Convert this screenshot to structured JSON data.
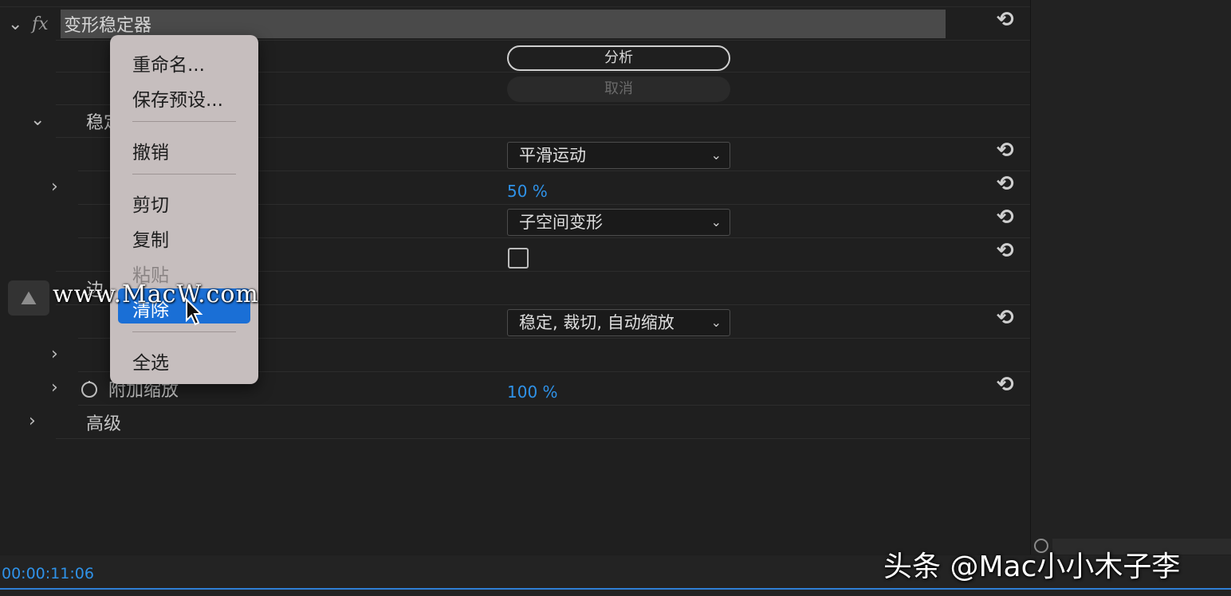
{
  "effect": {
    "name": "变形稳定器",
    "fx_label": "fx",
    "analyze_label": "分析",
    "cancel_label": "取消"
  },
  "sections": {
    "stabilize_partial": "稳定",
    "border_partial": "边",
    "extra_scale_label": "附加缩放",
    "advanced_label": "高级"
  },
  "params": {
    "result_value": "平滑运动",
    "smoothness_value": "50 %",
    "method_value": "子空间变形",
    "framing_value": "稳定, 裁切, 自动缩放",
    "extra_scale_value": "100 %"
  },
  "context_menu": {
    "items": [
      "重命名...",
      "保存预设...",
      "撤销",
      "剪切",
      "复制",
      "粘贴",
      "清除",
      "全选"
    ],
    "disabled": "粘贴",
    "highlighted": "清除"
  },
  "timecode": "00:00:11:06",
  "watermark": "www.MacW.com",
  "credit": "头条 @Mac小小木子李",
  "icons": {
    "reset": "reset-icon",
    "chevron_down": "chevron-down-icon",
    "chevron_right": "chevron-right-icon",
    "stopwatch": "stopwatch-icon",
    "cursor": "mouse-pointer-icon"
  },
  "colors": {
    "accent_blue": "#2f92e8",
    "menu_bg": "#c6bebe",
    "menu_highlight": "#1a6fd6"
  }
}
